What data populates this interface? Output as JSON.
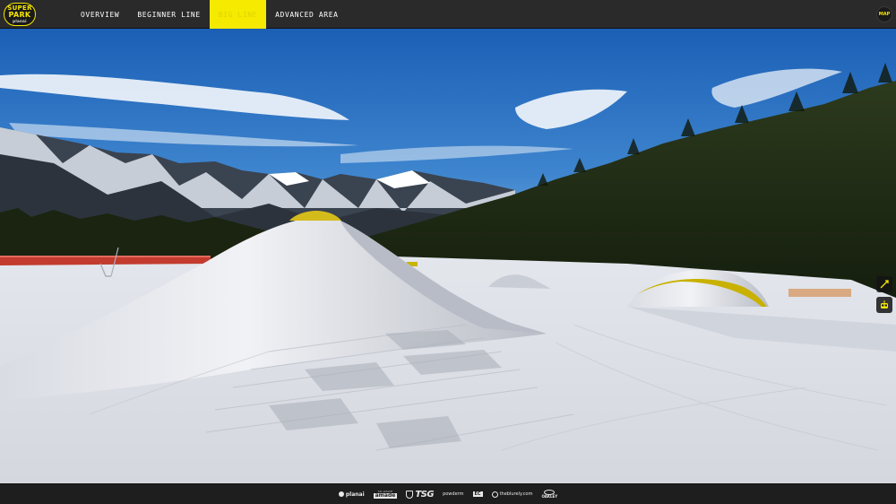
{
  "logo": {
    "line1": "SUPER",
    "line2": "PARK",
    "line3": "planai"
  },
  "nav": {
    "tabs": [
      {
        "label": "OVERVIEW",
        "active": false
      },
      {
        "label": "BEGINNER LINE",
        "active": false
      },
      {
        "label": "BIG LINE",
        "active": true
      },
      {
        "label": "ADVANCED AREA",
        "active": false
      }
    ]
  },
  "map_button": {
    "label": "MAP"
  },
  "side_tools": [
    {
      "icon": "rotate-icon"
    },
    {
      "icon": "gondola-icon"
    }
  ],
  "sponsors": {
    "planai": "planai",
    "amade_small": "SKI AMADÉ",
    "amade": "amadé",
    "tsg": "TSG",
    "powder": "powderm",
    "box": "EC",
    "burn": "theblurely.com",
    "oakley": "OAKLEY"
  },
  "colors": {
    "accent": "#f5ea00",
    "bar_background": "#2a2a2a",
    "sky_top": "#1e63b8",
    "snow": "#e9ecf1",
    "forest": "#1f2a14"
  }
}
